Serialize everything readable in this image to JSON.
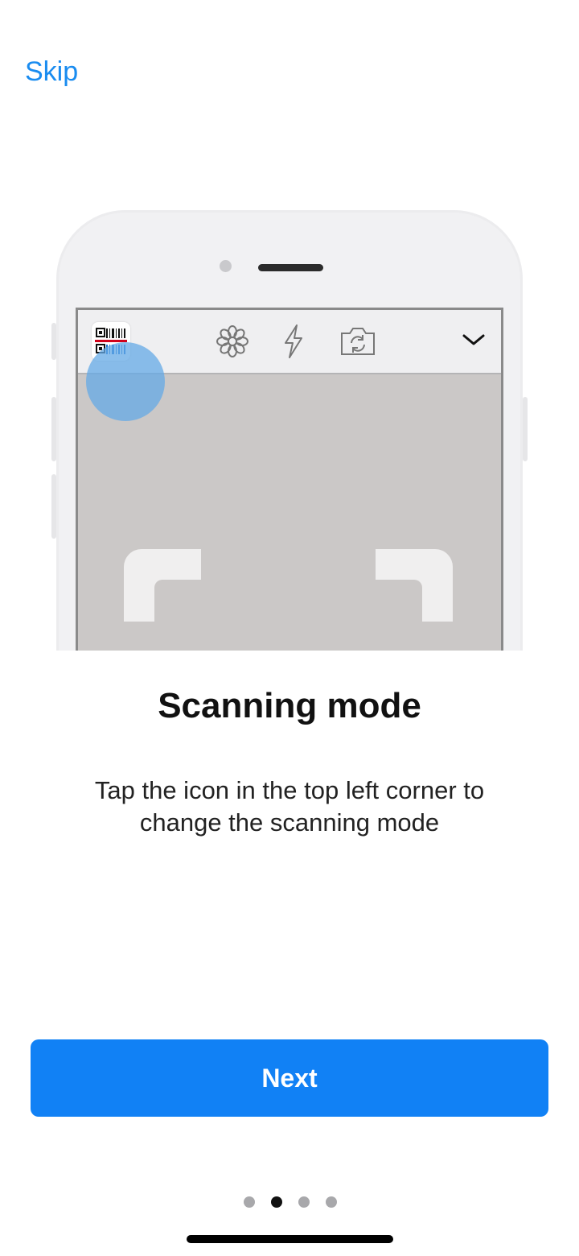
{
  "header": {
    "skip_label": "Skip"
  },
  "illustration": {
    "toolbar_icons": [
      "barcode-qr-icon",
      "flower-icon",
      "lightning-icon",
      "camera-rotate-icon",
      "chevron-down-icon"
    ]
  },
  "content": {
    "title": "Scanning mode",
    "description": "Tap the icon in the top left corner to change the scanning mode"
  },
  "actions": {
    "next_label": "Next"
  },
  "pager": {
    "pages": 4,
    "current": 2
  },
  "colors": {
    "accent": "#1181f5",
    "link": "#1a8cf0",
    "tap_highlight": "#64aae6"
  }
}
